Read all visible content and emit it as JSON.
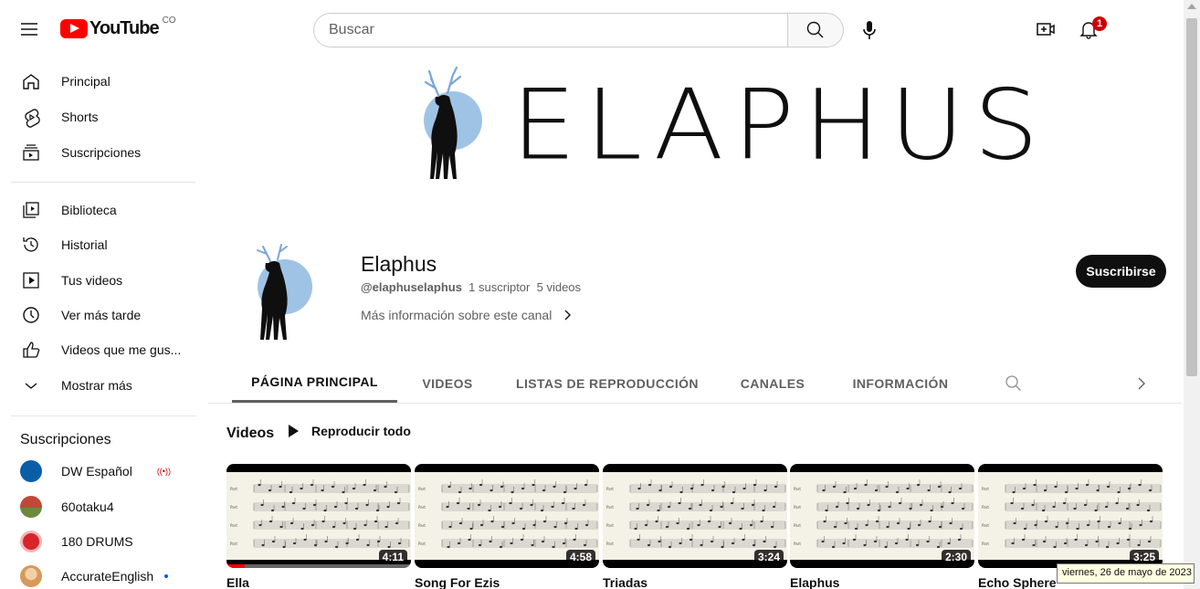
{
  "header": {
    "logo_word": "YouTube",
    "country_code": "CO",
    "search_placeholder": "Buscar",
    "notification_count": "1"
  },
  "sidebar": {
    "primary": [
      {
        "label": "Principal",
        "icon": "home-icon"
      },
      {
        "label": "Shorts",
        "icon": "shorts-icon"
      },
      {
        "label": "Suscripciones",
        "icon": "subscriptions-icon"
      }
    ],
    "library": [
      {
        "label": "Biblioteca",
        "icon": "library-icon"
      },
      {
        "label": "Historial",
        "icon": "history-icon"
      },
      {
        "label": "Tus videos",
        "icon": "your-videos-icon"
      },
      {
        "label": "Ver más tarde",
        "icon": "watch-later-icon"
      },
      {
        "label": "Videos que me gus...",
        "icon": "liked-videos-icon"
      },
      {
        "label": "Mostrar más",
        "icon": "chevron-down-icon"
      }
    ],
    "subscriptions_heading": "Suscripciones",
    "subscriptions": [
      {
        "label": "DW Español",
        "indicator": "live",
        "avatar_color": "#0a5ea8"
      },
      {
        "label": "60otaku4",
        "indicator": "",
        "avatar_color": "#b33c2a"
      },
      {
        "label": "180 DRUMS",
        "indicator": "",
        "avatar_color": "#d8232a"
      },
      {
        "label": "AccurateEnglish",
        "indicator": "new",
        "avatar_color": "#e0a060"
      }
    ],
    "live_symbol": "((•))"
  },
  "banner": {
    "title": "ELAPHUS"
  },
  "channel": {
    "name": "Elaphus",
    "handle": "@elaphuselaphus",
    "subscribers": "1 suscriptor",
    "videos_count": "5 videos",
    "more_info": "Más información sobre este canal",
    "subscribe_label": "Suscribirse"
  },
  "tabs": [
    {
      "label": "PÁGINA PRINCIPAL",
      "active": true
    },
    {
      "label": "VIDEOS",
      "active": false
    },
    {
      "label": "LISTAS DE REPRODUCCIÓN",
      "active": false
    },
    {
      "label": "CANALES",
      "active": false
    },
    {
      "label": "INFORMACIÓN",
      "active": false
    }
  ],
  "shelf": {
    "title": "Videos",
    "play_all": "Reproducir todo"
  },
  "videos": [
    {
      "title": "Ella",
      "duration": "4:11",
      "watched_fraction": 0.1
    },
    {
      "title": "Song For Ezis",
      "duration": "4:58",
      "watched_fraction": 0
    },
    {
      "title": "Triadas",
      "duration": "3:24",
      "watched_fraction": 0
    },
    {
      "title": "Elaphus",
      "duration": "2:30",
      "watched_fraction": 0
    },
    {
      "title": "Echo Sphere",
      "duration": "3:25",
      "watched_fraction": 0
    }
  ],
  "tooltip": {
    "date": "viernes, 26 de mayo de 2023"
  },
  "colors": {
    "brand_red": "#ff0000",
    "badge_red": "#cc0000",
    "deer_accent": "#8eb8e0",
    "subscribe_bg": "#0f0f0f"
  }
}
